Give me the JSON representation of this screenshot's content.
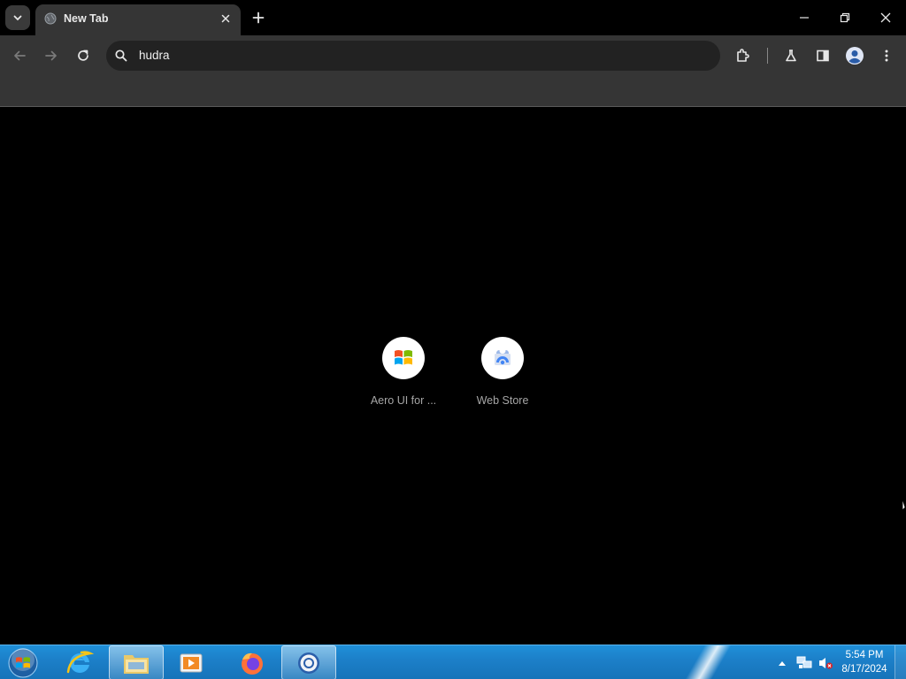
{
  "browser": {
    "tab": {
      "title": "New Tab"
    },
    "omnibox": {
      "value": "hudra"
    }
  },
  "shortcuts": [
    {
      "label": "Aero UI for ...",
      "icon": "windows-logo-icon"
    },
    {
      "label": "Web Store",
      "icon": "web-store-icon"
    }
  ],
  "taskbar": {
    "apps": [
      "internet-explorer-icon",
      "file-explorer-icon",
      "media-player-icon",
      "firefox-icon",
      "chrome-icon"
    ],
    "clock": {
      "time": "5:54 PM",
      "date": "8/17/2024"
    }
  },
  "colors": {
    "tab_bg": "#353535",
    "toolbar_bg": "#353535",
    "omnibox_bg": "#222222",
    "page_bg": "#000000",
    "taskbar_blue": "#1c7fc8"
  }
}
